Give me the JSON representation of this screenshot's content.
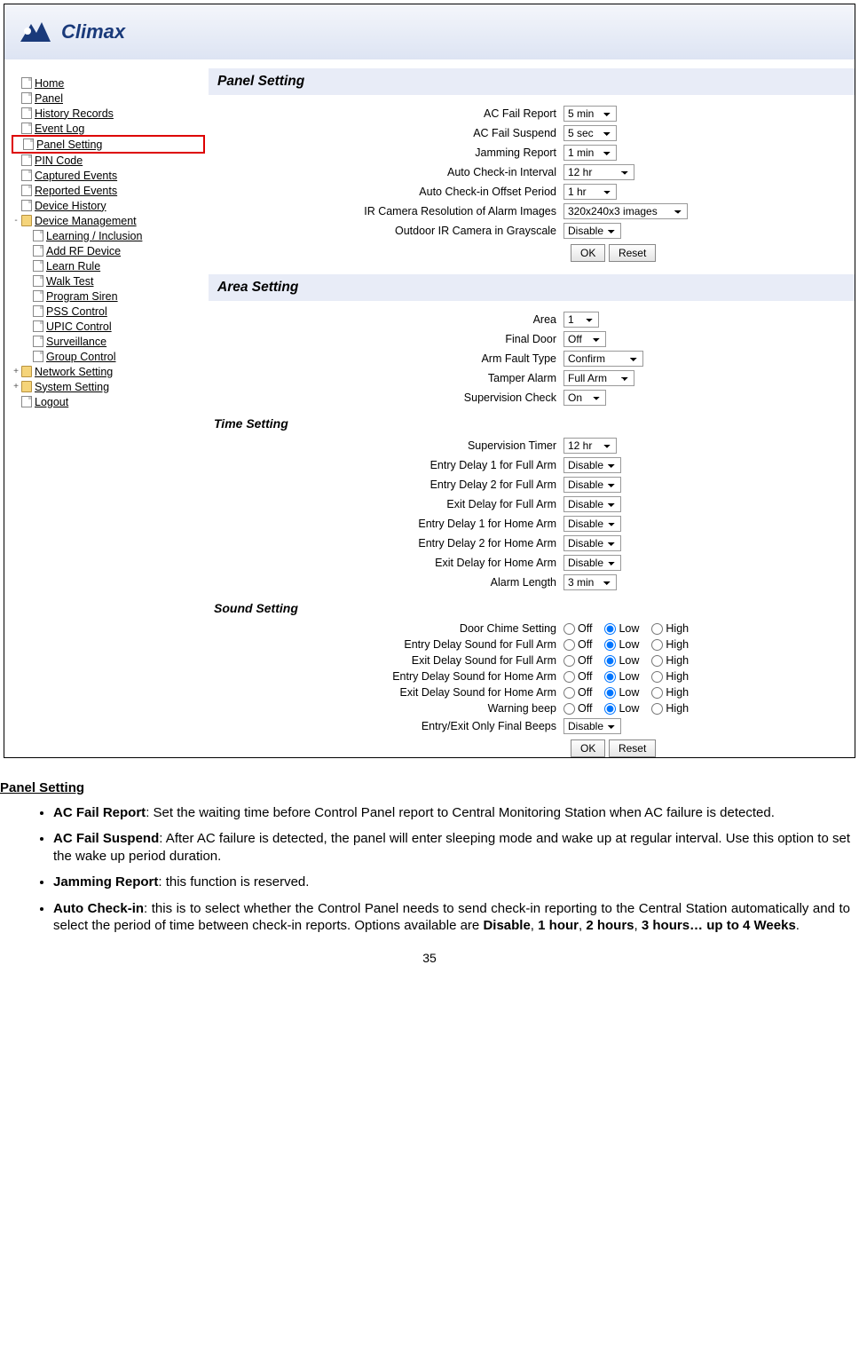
{
  "branding": {
    "name": "Climax"
  },
  "nav": {
    "items": [
      "Home",
      "Panel",
      "History Records",
      "Event Log",
      "Panel Setting",
      "PIN Code",
      "Captured Events",
      "Reported Events",
      "Device History"
    ],
    "dm_label": "Device Management",
    "dm_items": [
      "Learning / Inclusion",
      "Add RF Device",
      "Learn Rule",
      "Walk Test",
      "Program Siren",
      "PSS Control",
      "UPIC Control",
      "Surveillance",
      "Group Control"
    ],
    "net_label": "Network Setting",
    "sys_label": "System Setting",
    "logout": "Logout"
  },
  "panel": {
    "heading": "Panel Setting",
    "rows": {
      "ac_fail_report": {
        "label": "AC Fail Report",
        "value": "5 min"
      },
      "ac_fail_suspend": {
        "label": "AC Fail Suspend",
        "value": "5 sec"
      },
      "jamming_report": {
        "label": "Jamming Report",
        "value": "1 min"
      },
      "auto_checkin": {
        "label": "Auto Check-in Interval",
        "value": "12 hr"
      },
      "auto_offset": {
        "label": "Auto Check-in Offset Period",
        "value": "1 hr"
      },
      "ir_res": {
        "label": "IR Camera Resolution of Alarm Images",
        "value": "320x240x3 images"
      },
      "outdoor_ir": {
        "label": "Outdoor IR Camera in Grayscale",
        "value": "Disable"
      }
    },
    "ok": "OK",
    "reset": "Reset"
  },
  "area": {
    "heading": "Area Setting",
    "rows": {
      "area": {
        "label": "Area",
        "value": "1"
      },
      "final_door": {
        "label": "Final Door",
        "value": "Off"
      },
      "arm_fault": {
        "label": "Arm Fault Type",
        "value": "Confirm"
      },
      "tamper": {
        "label": "Tamper Alarm",
        "value": "Full Arm"
      },
      "supervision": {
        "label": "Supervision Check",
        "value": "On"
      }
    },
    "time_heading": "Time Setting",
    "time_rows": {
      "sup_timer": {
        "label": "Supervision Timer",
        "value": "12 hr"
      },
      "ed1_full": {
        "label": "Entry Delay 1 for Full Arm",
        "value": "Disable"
      },
      "ed2_full": {
        "label": "Entry Delay 2 for Full Arm",
        "value": "Disable"
      },
      "xd_full": {
        "label": "Exit Delay for Full Arm",
        "value": "Disable"
      },
      "ed1_home": {
        "label": "Entry Delay 1 for Home Arm",
        "value": "Disable"
      },
      "ed2_home": {
        "label": "Entry Delay 2 for Home Arm",
        "value": "Disable"
      },
      "xd_home": {
        "label": "Exit Delay for Home Arm",
        "value": "Disable"
      },
      "alarm_len": {
        "label": "Alarm Length",
        "value": "3 min"
      }
    },
    "sound_heading": "Sound Setting",
    "sound_rows": {
      "door_chime": "Door Chime Setting",
      "eds_full": "Entry Delay Sound for Full Arm",
      "xds_full": "Exit Delay Sound for Full Arm",
      "eds_home": "Entry Delay Sound for Home Arm",
      "xds_home": "Exit Delay Sound for Home Arm",
      "warn_beep": "Warning beep"
    },
    "radio_opts": {
      "off": "Off",
      "low": "Low",
      "high": "High"
    },
    "final_beeps": {
      "label": "Entry/Exit Only Final Beeps",
      "value": "Disable"
    },
    "ok": "OK",
    "reset": "Reset"
  },
  "doc": {
    "heading": "Panel Setting",
    "b1_t": "AC Fail Report",
    "b1_r": ": Set the waiting time before Control Panel report to Central Monitoring Station when AC failure is detected.",
    "b2_t": "AC Fail Suspend",
    "b2_r": ": After AC failure is detected, the panel will enter sleeping mode and wake up at regular interval. Use this option to set the wake up period duration.",
    "b3_t": "Jamming Report",
    "b3_r": ": this function is reserved.",
    "b4_t": "Auto Check-in",
    "b4_r1": ": this is to select whether the Control Panel needs to send check-in reporting to the Central Station automatically and to select the period of time between check-in reports. Options available are ",
    "b4_o1": "Disable",
    "b4_c1": ", ",
    "b4_o2": "1 hour",
    "b4_c2": ", ",
    "b4_o3": "2 hours",
    "b4_c3": ", ",
    "b4_o4": "3 hours… up to 4 Weeks",
    "b4_end": "."
  },
  "page_number": "35"
}
